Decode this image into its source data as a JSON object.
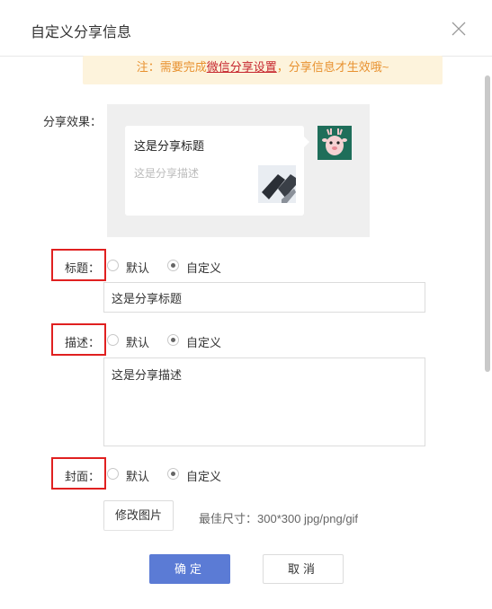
{
  "dialog": {
    "title": "自定义分享信息",
    "close_icon": "close-icon"
  },
  "notice": {
    "prefix": "注：需要完成",
    "link": "微信分享设置",
    "suffix": "，分享信息才生效哦~"
  },
  "preview": {
    "label": "分享效果：",
    "card_title": "这是分享标题",
    "card_desc": "这是分享描述",
    "thumb_icon": "laptop-photo-thumbnail",
    "avatar_icon": "cartoon-deer-avatar"
  },
  "title_field": {
    "label": "标题：",
    "options": [
      "默认",
      "自定义"
    ],
    "selected": "自定义",
    "value": "这是分享标题"
  },
  "desc_field": {
    "label": "描述：",
    "options": [
      "默认",
      "自定义"
    ],
    "selected": "自定义",
    "value": "这是分享描述"
  },
  "cover_field": {
    "label": "封面：",
    "options": [
      "默认",
      "自定义"
    ],
    "selected": "自定义",
    "button": "修改图片",
    "hint": "最佳尺寸：300*300 jpg/png/gif"
  },
  "footer": {
    "confirm": "确定",
    "cancel": "取消"
  },
  "colors": {
    "primary": "#5b7bd5",
    "notice_bg": "#fdf3dc",
    "notice_text": "#e8912f",
    "highlight_border": "#e02020"
  }
}
